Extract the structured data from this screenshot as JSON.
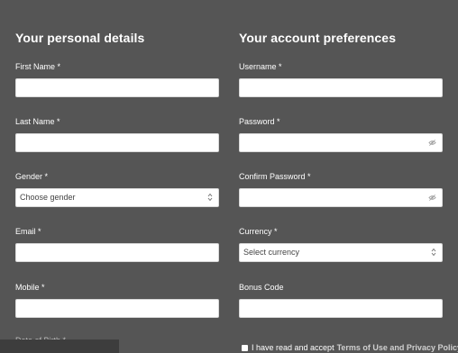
{
  "personal": {
    "heading": "Your personal details",
    "first_name_label": "First Name *",
    "last_name_label": "Last Name *",
    "gender_label": "Gender *",
    "gender_value": "Choose gender",
    "email_label": "Email *",
    "mobile_label": "Mobile *",
    "partial_label": "Date of Birth *"
  },
  "account": {
    "heading": "Your account preferences",
    "username_label": "Username *",
    "password_label": "Password *",
    "confirm_password_label": "Confirm Password *",
    "currency_label": "Currency *",
    "currency_value": "Select currency",
    "bonus_code_label": "Bonus Code"
  },
  "terms": {
    "prefix": "I have read and accept",
    "link": "Terms of Use and Privacy Policy"
  },
  "icons": {
    "select": "select-arrows-icon",
    "password_toggle": "eye-slash-icon"
  },
  "colors": {
    "background": "#555555",
    "field": "#ffffff",
    "text": "#ffffff"
  }
}
